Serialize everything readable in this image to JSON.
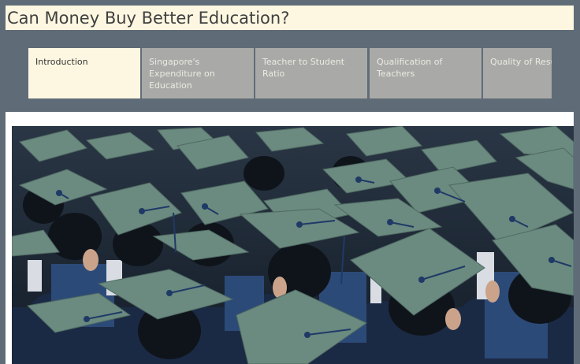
{
  "header": {
    "title": "Can Money Buy Better Education?"
  },
  "tabs": [
    {
      "label": "Introduction",
      "active": true
    },
    {
      "label": "Singapore's Expenditure on Education",
      "active": false
    },
    {
      "label": "Teacher to Student Ratio",
      "active": false
    },
    {
      "label": "Qualification of Teachers",
      "active": false
    },
    {
      "label": "Quality of Results",
      "active": false
    }
  ],
  "colors": {
    "background": "#5f6c78",
    "title_background": "#fdf7e1",
    "active_tab": "#fdf7e1",
    "inactive_tab": "#a9aaa7",
    "cap": "#6b8a80",
    "tassel": "#1f3a66"
  }
}
